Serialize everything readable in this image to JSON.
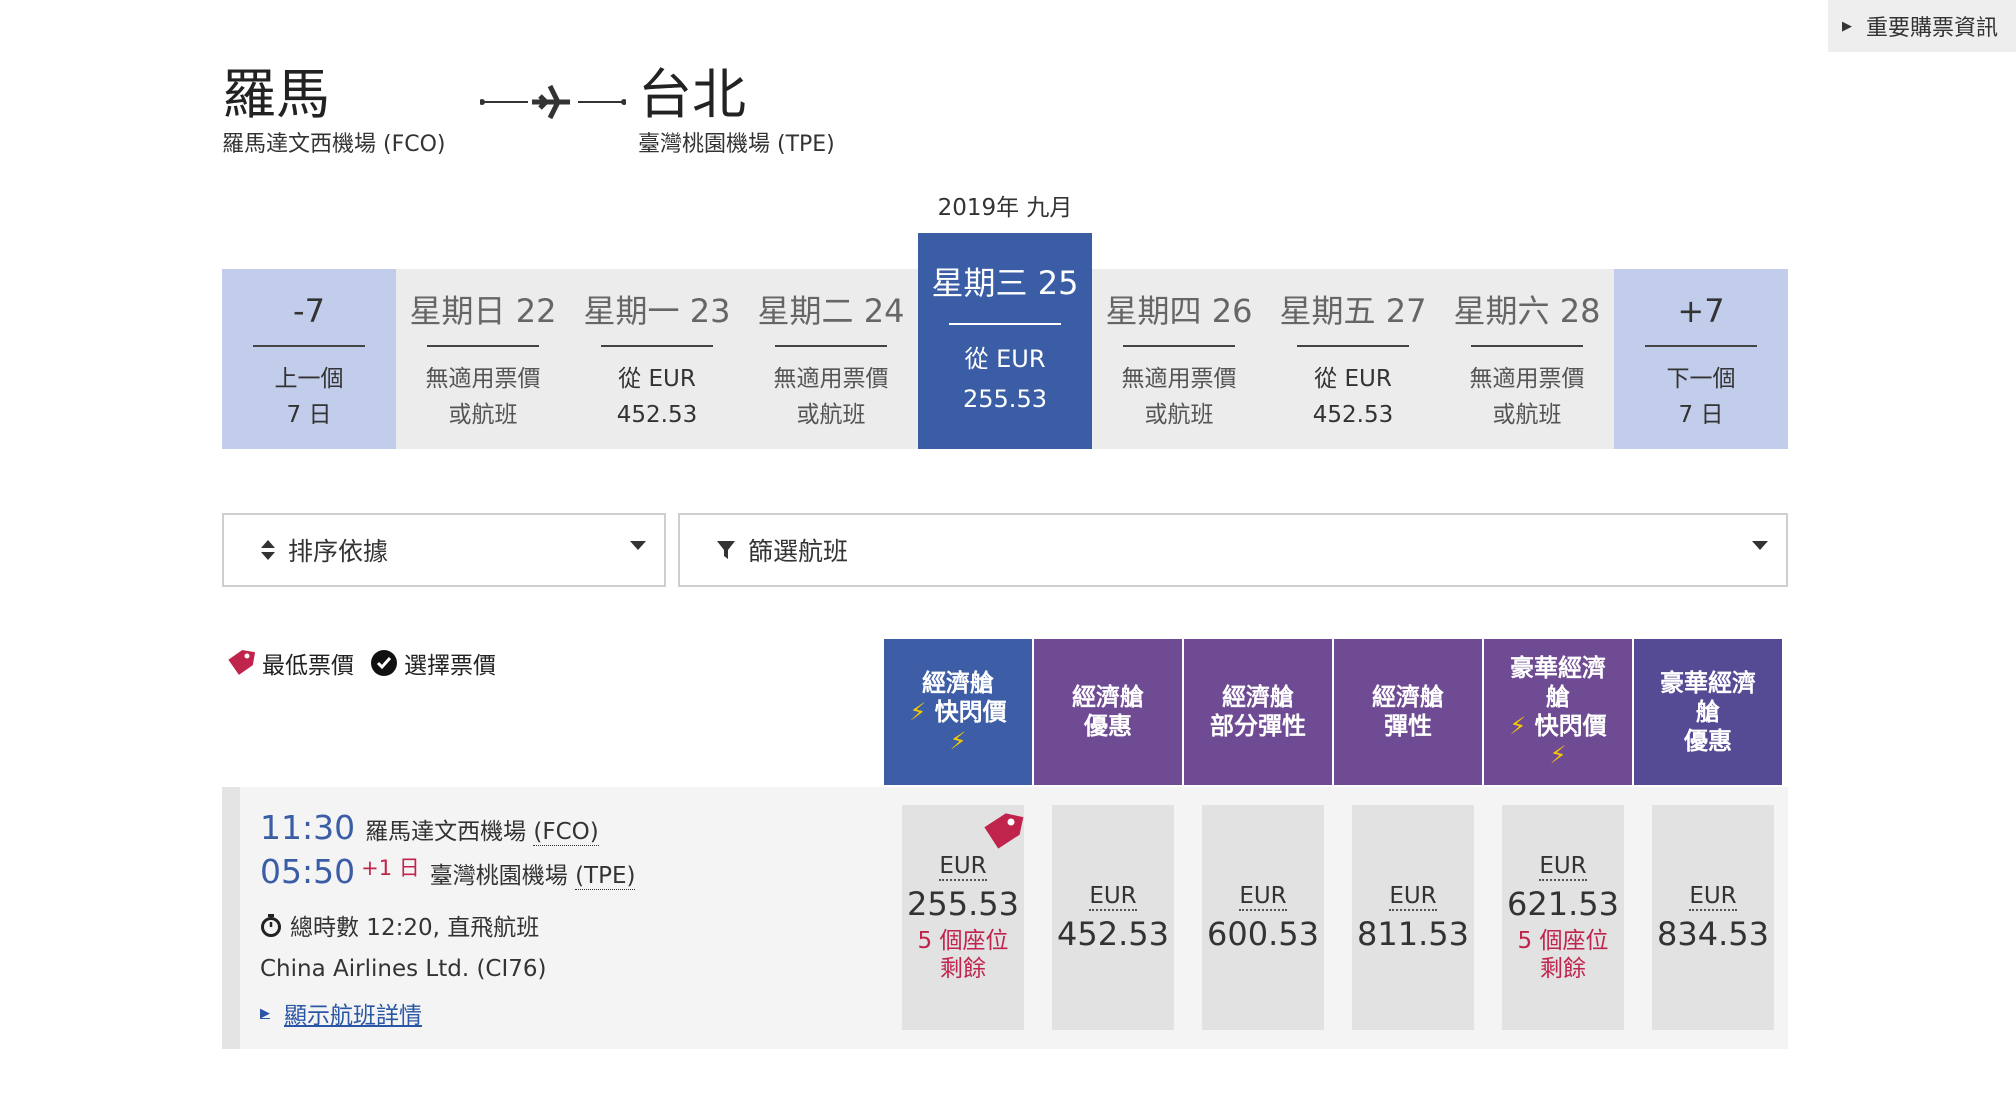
{
  "notice": {
    "label": "重要購票資訊"
  },
  "route": {
    "origin": {
      "city": "羅馬",
      "airport": "羅馬達文西機場 (FCO)"
    },
    "destination": {
      "city": "台北",
      "airport": "臺灣桃園機場 (TPE)"
    }
  },
  "month_label": "2019年 九月",
  "date_strip": [
    {
      "head": "-7",
      "line1": "上一個",
      "line2": "7 日",
      "kind": "nav"
    },
    {
      "head": "星期日 22",
      "line1": "無適用票價",
      "line2": "或航班",
      "kind": "empty"
    },
    {
      "head": "星期一 23",
      "line1": "從 EUR",
      "line2": "452.53",
      "kind": "price"
    },
    {
      "head": "星期二 24",
      "line1": "無適用票價",
      "line2": "或航班",
      "kind": "empty"
    },
    {
      "head": "星期三 25",
      "line1": "從 EUR",
      "line2": "255.53",
      "kind": "selected"
    },
    {
      "head": "星期四 26",
      "line1": "無適用票價",
      "line2": "或航班",
      "kind": "empty"
    },
    {
      "head": "星期五 27",
      "line1": "從 EUR",
      "line2": "452.53",
      "kind": "price"
    },
    {
      "head": "星期六 28",
      "line1": "無適用票價",
      "line2": "或航班",
      "kind": "empty"
    },
    {
      "head": "+7",
      "line1": "下一個",
      "line2": "7 日",
      "kind": "nav"
    }
  ],
  "controls": {
    "sort_label": "排序依據",
    "filter_label": "篩選航班"
  },
  "legend": {
    "lowest": "最低票價",
    "selected": "選擇票價"
  },
  "fare_headers": [
    {
      "lines": [
        "經濟艙",
        "快閃價"
      ],
      "flash": true,
      "color": "blue"
    },
    {
      "lines": [
        "經濟艙",
        "優惠"
      ],
      "flash": false,
      "color": "purple"
    },
    {
      "lines": [
        "經濟艙",
        "部分彈性"
      ],
      "flash": false,
      "color": "purple"
    },
    {
      "lines": [
        "經濟艙",
        "彈性"
      ],
      "flash": false,
      "color": "purple"
    },
    {
      "lines": [
        "豪華經濟",
        "艙",
        "快閃價"
      ],
      "flash": true,
      "color": "purple"
    },
    {
      "lines": [
        "豪華經濟",
        "艙",
        "優惠"
      ],
      "flash": false,
      "color": "royal"
    }
  ],
  "flight": {
    "depart_time": "11:30",
    "depart_airport": "羅馬達文西機場 ",
    "depart_code": "(FCO)",
    "arrive_time": "05:50",
    "arrive_plus": "+1 日",
    "arrive_airport": "臺灣桃園機場 ",
    "arrive_code": "(TPE)",
    "duration": "總時數 12:20, 直飛航班",
    "carrier": "China Airlines Ltd. (CI76)",
    "details_link": "顯示航班詳情",
    "fares": [
      {
        "currency": "EUR",
        "amount": "255.53",
        "seats": [
          "5 個座位",
          "剩餘"
        ],
        "lowest": true
      },
      {
        "currency": "EUR",
        "amount": "452.53",
        "seats": [],
        "lowest": false
      },
      {
        "currency": "EUR",
        "amount": "600.53",
        "seats": [],
        "lowest": false
      },
      {
        "currency": "EUR",
        "amount": "811.53",
        "seats": [],
        "lowest": false
      },
      {
        "currency": "EUR",
        "amount": "621.53",
        "seats": [
          "5 個座位",
          "剩餘"
        ],
        "lowest": false
      },
      {
        "currency": "EUR",
        "amount": "834.53",
        "seats": [],
        "lowest": false
      }
    ]
  },
  "colors": {
    "brand_blue": "#3a5da6",
    "fare_purple": "#6f4b94",
    "alert_red": "#c0234b",
    "nav_blue": "#c2cdec"
  }
}
